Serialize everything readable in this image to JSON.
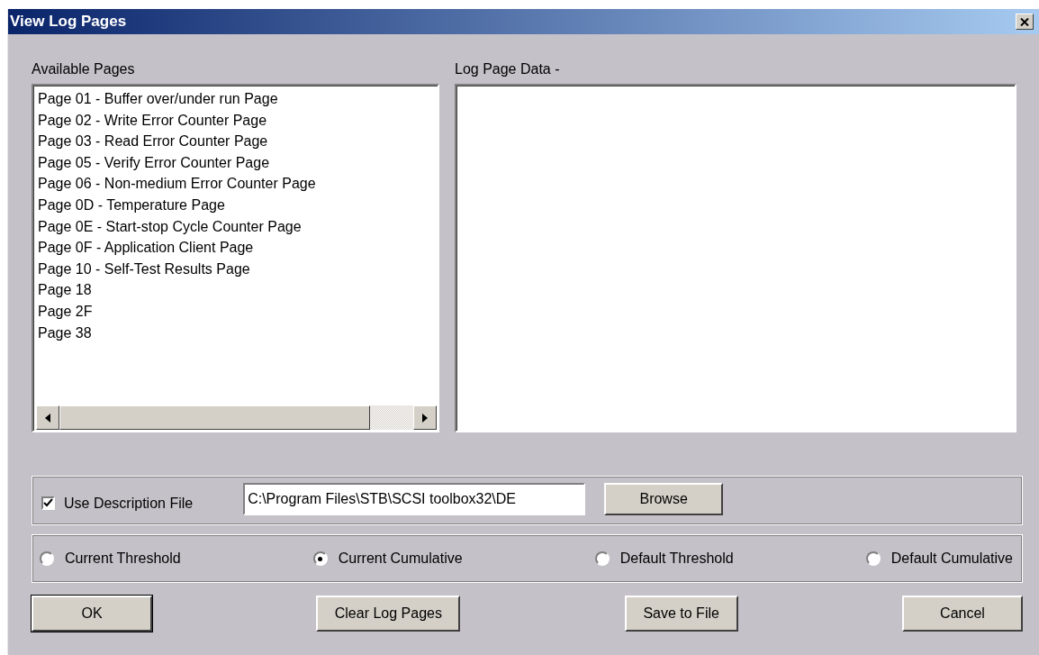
{
  "window": {
    "title": "View Log Pages"
  },
  "available_pages": {
    "label": "Available Pages",
    "items": [
      {
        "text": "Page 01 - Buffer over/under run Page"
      },
      {
        "text": "Page 02 - Write Error Counter Page"
      },
      {
        "text": "Page 03 - Read Error Counter Page"
      },
      {
        "text": "Page 05 - Verify Error Counter Page"
      },
      {
        "text": "Page 06 - Non-medium Error Counter Page"
      },
      {
        "text": "Page 0D - Temperature Page"
      },
      {
        "text": "Page 0E - Start-stop Cycle Counter Page"
      },
      {
        "text": "Page 0F - Application Client Page"
      },
      {
        "text": "Page 10 - Self-Test Results Page"
      },
      {
        "text": "Page 18"
      },
      {
        "text": "Page 2F"
      },
      {
        "text": "Page 38"
      }
    ]
  },
  "log_page_data": {
    "label": "Log Page Data -"
  },
  "description_file": {
    "label": "Use Description File",
    "checked": true,
    "value": "C:\\Program Files\\STB\\SCSI toolbox32\\DE",
    "browse": "Browse"
  },
  "modes": [
    {
      "label": "Current Threshold",
      "selected": false
    },
    {
      "label": "Current Cumulative",
      "selected": true
    },
    {
      "label": "Default Threshold",
      "selected": false
    },
    {
      "label": "Default Cumulative",
      "selected": false
    }
  ],
  "buttons": [
    {
      "label": "OK",
      "default": true
    },
    {
      "label": "Clear Log Pages",
      "default": false
    },
    {
      "label": "Save to File",
      "default": false
    },
    {
      "label": "Cancel",
      "default": false
    }
  ]
}
